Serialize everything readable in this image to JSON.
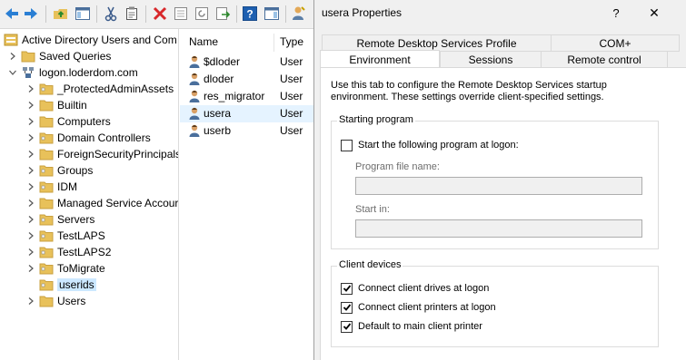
{
  "toolbar": {
    "icons": [
      "back-arrow-icon",
      "forward-arrow-icon",
      "up-folder-icon",
      "show-hide-console-tree-icon",
      "cut-icon",
      "copy-icon",
      "delete-icon",
      "properties-icon",
      "refresh-icon",
      "export-list-icon",
      "help-icon",
      "show-hide-action-pane-icon",
      "delegate-control-icon"
    ]
  },
  "tree": {
    "root_label": "Active Directory Users and Com",
    "items": [
      {
        "label": "Saved Queries"
      },
      {
        "label": "logon.loderdom.com"
      },
      {
        "label": "_ProtectedAdminAssets"
      },
      {
        "label": "Builtin"
      },
      {
        "label": "Computers"
      },
      {
        "label": "Domain Controllers"
      },
      {
        "label": "ForeignSecurityPrincipals"
      },
      {
        "label": "Groups"
      },
      {
        "label": "IDM"
      },
      {
        "label": "Managed Service Accour"
      },
      {
        "label": "Servers"
      },
      {
        "label": "TestLAPS"
      },
      {
        "label": "TestLAPS2"
      },
      {
        "label": "ToMigrate"
      },
      {
        "label": "userids"
      },
      {
        "label": "Users"
      }
    ],
    "selected": "userids"
  },
  "list": {
    "columns": [
      "Name",
      "Type"
    ],
    "rows": [
      {
        "name": "$dloder",
        "type": "User"
      },
      {
        "name": "dloder",
        "type": "User"
      },
      {
        "name": "res_migrator",
        "type": "User"
      },
      {
        "name": "usera",
        "type": "User"
      },
      {
        "name": "userb",
        "type": "User"
      }
    ],
    "selected": "usera"
  },
  "dialog": {
    "title": "usera Properties",
    "help_glyph": "?",
    "close_glyph": "✕",
    "tabs_row1": [
      "Remote Desktop Services Profile",
      "COM+"
    ],
    "tabs_row2": [
      "Environment",
      "Sessions",
      "Remote control"
    ],
    "active_tab": "Environment",
    "description": "Use this tab to configure the Remote Desktop Services startup environment. These settings override client-specified settings.",
    "starting_program": {
      "legend": "Starting program",
      "checkbox_label": "Start the following program at logon:",
      "checked": false,
      "program_file_label": "Program file name:",
      "program_file_value": "",
      "start_in_label": "Start in:",
      "start_in_value": ""
    },
    "client_devices": {
      "legend": "Client devices",
      "options": [
        {
          "label": "Connect client drives at logon",
          "checked": true
        },
        {
          "label": "Connect client printers at logon",
          "checked": true
        },
        {
          "label": "Default to main client printer",
          "checked": true
        }
      ]
    }
  },
  "colors": {
    "selection": "#cce8ff",
    "folder": "#e8c15a",
    "dialog_bg": "#f0f0f0"
  }
}
